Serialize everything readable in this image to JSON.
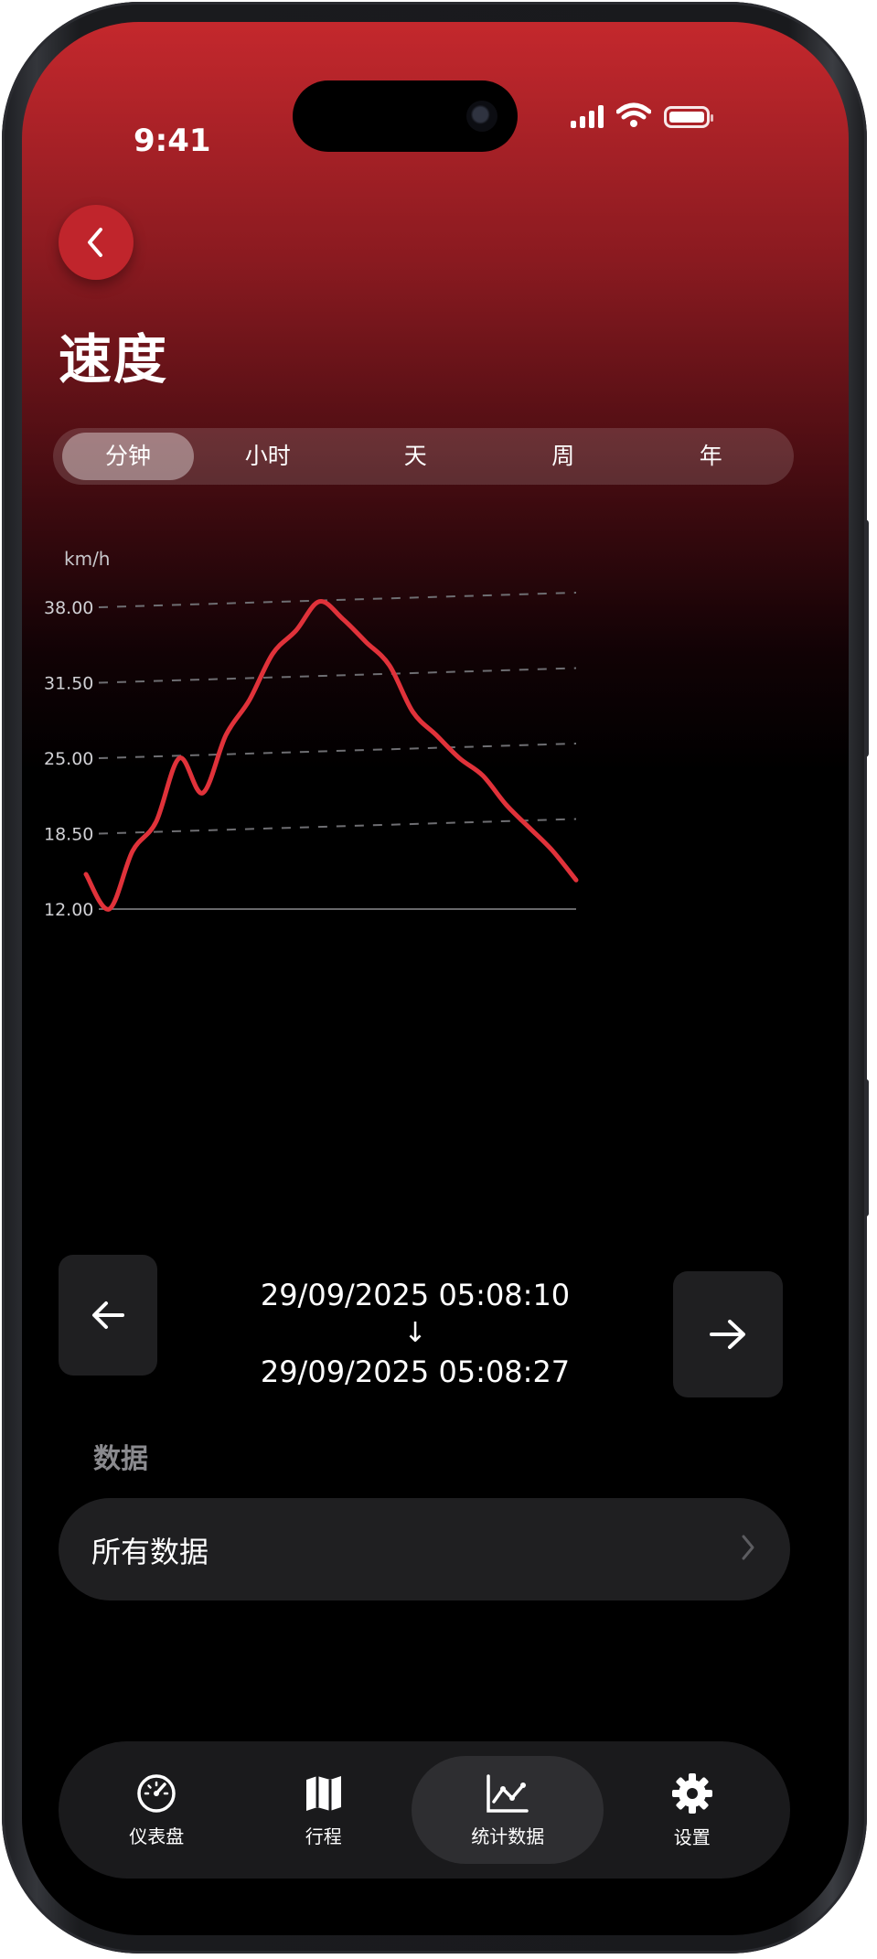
{
  "status_bar": {
    "time": "9:41"
  },
  "header": {
    "title": "速度",
    "back_icon": "chevron-left-icon"
  },
  "segments": {
    "tabs": [
      "分钟",
      "小时",
      "天",
      "周",
      "年"
    ],
    "selected": "分钟"
  },
  "chart_data": {
    "type": "line",
    "unit_label": "km/h",
    "y_ticks": [
      "38.00",
      "31.50",
      "25.00",
      "18.50",
      "12.00"
    ],
    "ylim": [
      12,
      38
    ],
    "grid": true,
    "line_color": "#e0323a",
    "series": [
      {
        "x": [
          0,
          1,
          2,
          3,
          4,
          5,
          6,
          7,
          8,
          9,
          10,
          11,
          12,
          13,
          14,
          15,
          16,
          17,
          18,
          19,
          20,
          21
        ],
        "values": [
          15,
          12,
          17,
          19.5,
          25,
          22,
          27,
          30,
          34,
          36,
          38.5,
          37,
          35,
          33,
          29,
          27,
          25,
          23.5,
          21,
          19,
          17,
          14.5
        ]
      }
    ]
  },
  "range": {
    "start": "29/09/2025 05:08:10",
    "arrow": "↓",
    "end": "29/09/2025 05:08:27",
    "prev_icon": "arrow-left-icon",
    "next_icon": "arrow-right-icon"
  },
  "data_section": {
    "heading": "数据",
    "row_label": "所有数据"
  },
  "tab_bar": {
    "items": [
      {
        "label": "仪表盘",
        "icon": "speedometer-icon"
      },
      {
        "label": "行程",
        "icon": "map-icon"
      },
      {
        "label": "统计数据",
        "icon": "chart-icon"
      },
      {
        "label": "设置",
        "icon": "gear-icon"
      }
    ],
    "active": "统计数据"
  },
  "colors": {
    "accent": "#c0252c",
    "background": "#000000",
    "card": "#1f1f21"
  }
}
